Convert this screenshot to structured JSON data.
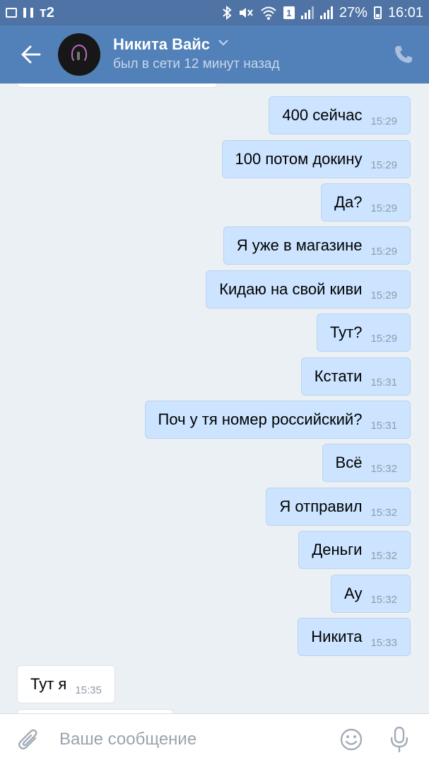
{
  "status_bar": {
    "carrier": "т2",
    "sim_slot": "1",
    "battery": "27%",
    "time": "16:01"
  },
  "header": {
    "name": "Никита Вайс",
    "status": "был в сети 12 минут назад"
  },
  "messages": [
    {
      "direction": "out",
      "text": "400 сейчас",
      "time": "15:29"
    },
    {
      "direction": "out",
      "text": "100 потом докину",
      "time": "15:29"
    },
    {
      "direction": "out",
      "text": "Да?",
      "time": "15:29"
    },
    {
      "direction": "out",
      "text": "Я уже в магазине",
      "time": "15:29"
    },
    {
      "direction": "out",
      "text": "Кидаю на свой киви",
      "time": "15:29"
    },
    {
      "direction": "out",
      "text": "Тут?",
      "time": "15:29"
    },
    {
      "direction": "out",
      "text": "Кстати",
      "time": "15:31"
    },
    {
      "direction": "out",
      "text": "Поч у тя номер российский?",
      "time": "15:31"
    },
    {
      "direction": "out",
      "text": "Всё",
      "time": "15:32"
    },
    {
      "direction": "out",
      "text": "Я отправил",
      "time": "15:32"
    },
    {
      "direction": "out",
      "text": "Деньги",
      "time": "15:32"
    },
    {
      "direction": "out",
      "text": "Ау",
      "time": "15:32"
    },
    {
      "direction": "out",
      "text": "Никита",
      "time": "15:33"
    },
    {
      "direction": "in",
      "text": "Тут я",
      "time": "15:35"
    }
  ],
  "composer": {
    "placeholder": "Ваше сообщение",
    "value": ""
  },
  "colors": {
    "header_bg": "#5181b8",
    "status_bar_bg": "#4f73a5",
    "chat_bg": "#ebf0f5",
    "outgoing_bubble": "#cce4ff",
    "incoming_bubble": "#ffffff",
    "time_text": "#8e9bab"
  },
  "icons": {
    "back": "arrow-left-icon",
    "dropdown": "chevron-down-icon",
    "call": "phone-icon",
    "attach": "paperclip-icon",
    "emoji": "smiley-icon",
    "voice": "microphone-icon"
  }
}
